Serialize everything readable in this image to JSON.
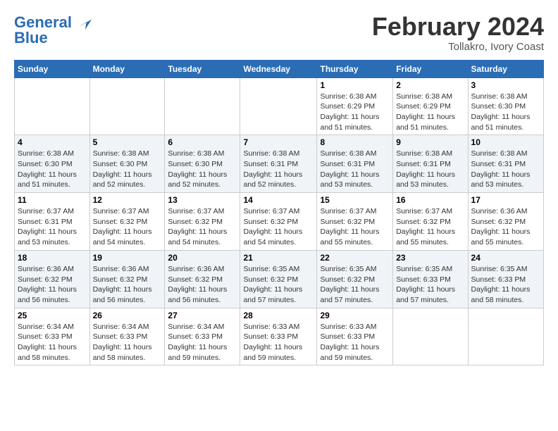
{
  "logo": {
    "line1": "General",
    "line2": "Blue"
  },
  "title": "February 2024",
  "subtitle": "Tollakro, Ivory Coast",
  "days_header": [
    "Sunday",
    "Monday",
    "Tuesday",
    "Wednesday",
    "Thursday",
    "Friday",
    "Saturday"
  ],
  "weeks": [
    [
      {
        "day": "",
        "info": ""
      },
      {
        "day": "",
        "info": ""
      },
      {
        "day": "",
        "info": ""
      },
      {
        "day": "",
        "info": ""
      },
      {
        "day": "1",
        "info": "Sunrise: 6:38 AM\nSunset: 6:29 PM\nDaylight: 11 hours\nand 51 minutes."
      },
      {
        "day": "2",
        "info": "Sunrise: 6:38 AM\nSunset: 6:29 PM\nDaylight: 11 hours\nand 51 minutes."
      },
      {
        "day": "3",
        "info": "Sunrise: 6:38 AM\nSunset: 6:30 PM\nDaylight: 11 hours\nand 51 minutes."
      }
    ],
    [
      {
        "day": "4",
        "info": "Sunrise: 6:38 AM\nSunset: 6:30 PM\nDaylight: 11 hours\nand 51 minutes."
      },
      {
        "day": "5",
        "info": "Sunrise: 6:38 AM\nSunset: 6:30 PM\nDaylight: 11 hours\nand 52 minutes."
      },
      {
        "day": "6",
        "info": "Sunrise: 6:38 AM\nSunset: 6:30 PM\nDaylight: 11 hours\nand 52 minutes."
      },
      {
        "day": "7",
        "info": "Sunrise: 6:38 AM\nSunset: 6:31 PM\nDaylight: 11 hours\nand 52 minutes."
      },
      {
        "day": "8",
        "info": "Sunrise: 6:38 AM\nSunset: 6:31 PM\nDaylight: 11 hours\nand 53 minutes."
      },
      {
        "day": "9",
        "info": "Sunrise: 6:38 AM\nSunset: 6:31 PM\nDaylight: 11 hours\nand 53 minutes."
      },
      {
        "day": "10",
        "info": "Sunrise: 6:38 AM\nSunset: 6:31 PM\nDaylight: 11 hours\nand 53 minutes."
      }
    ],
    [
      {
        "day": "11",
        "info": "Sunrise: 6:37 AM\nSunset: 6:31 PM\nDaylight: 11 hours\nand 53 minutes."
      },
      {
        "day": "12",
        "info": "Sunrise: 6:37 AM\nSunset: 6:32 PM\nDaylight: 11 hours\nand 54 minutes."
      },
      {
        "day": "13",
        "info": "Sunrise: 6:37 AM\nSunset: 6:32 PM\nDaylight: 11 hours\nand 54 minutes."
      },
      {
        "day": "14",
        "info": "Sunrise: 6:37 AM\nSunset: 6:32 PM\nDaylight: 11 hours\nand 54 minutes."
      },
      {
        "day": "15",
        "info": "Sunrise: 6:37 AM\nSunset: 6:32 PM\nDaylight: 11 hours\nand 55 minutes."
      },
      {
        "day": "16",
        "info": "Sunrise: 6:37 AM\nSunset: 6:32 PM\nDaylight: 11 hours\nand 55 minutes."
      },
      {
        "day": "17",
        "info": "Sunrise: 6:36 AM\nSunset: 6:32 PM\nDaylight: 11 hours\nand 55 minutes."
      }
    ],
    [
      {
        "day": "18",
        "info": "Sunrise: 6:36 AM\nSunset: 6:32 PM\nDaylight: 11 hours\nand 56 minutes."
      },
      {
        "day": "19",
        "info": "Sunrise: 6:36 AM\nSunset: 6:32 PM\nDaylight: 11 hours\nand 56 minutes."
      },
      {
        "day": "20",
        "info": "Sunrise: 6:36 AM\nSunset: 6:32 PM\nDaylight: 11 hours\nand 56 minutes."
      },
      {
        "day": "21",
        "info": "Sunrise: 6:35 AM\nSunset: 6:32 PM\nDaylight: 11 hours\nand 57 minutes."
      },
      {
        "day": "22",
        "info": "Sunrise: 6:35 AM\nSunset: 6:32 PM\nDaylight: 11 hours\nand 57 minutes."
      },
      {
        "day": "23",
        "info": "Sunrise: 6:35 AM\nSunset: 6:33 PM\nDaylight: 11 hours\nand 57 minutes."
      },
      {
        "day": "24",
        "info": "Sunrise: 6:35 AM\nSunset: 6:33 PM\nDaylight: 11 hours\nand 58 minutes."
      }
    ],
    [
      {
        "day": "25",
        "info": "Sunrise: 6:34 AM\nSunset: 6:33 PM\nDaylight: 11 hours\nand 58 minutes."
      },
      {
        "day": "26",
        "info": "Sunrise: 6:34 AM\nSunset: 6:33 PM\nDaylight: 11 hours\nand 58 minutes."
      },
      {
        "day": "27",
        "info": "Sunrise: 6:34 AM\nSunset: 6:33 PM\nDaylight: 11 hours\nand 59 minutes."
      },
      {
        "day": "28",
        "info": "Sunrise: 6:33 AM\nSunset: 6:33 PM\nDaylight: 11 hours\nand 59 minutes."
      },
      {
        "day": "29",
        "info": "Sunrise: 6:33 AM\nSunset: 6:33 PM\nDaylight: 11 hours\nand 59 minutes."
      },
      {
        "day": "",
        "info": ""
      },
      {
        "day": "",
        "info": ""
      }
    ]
  ]
}
